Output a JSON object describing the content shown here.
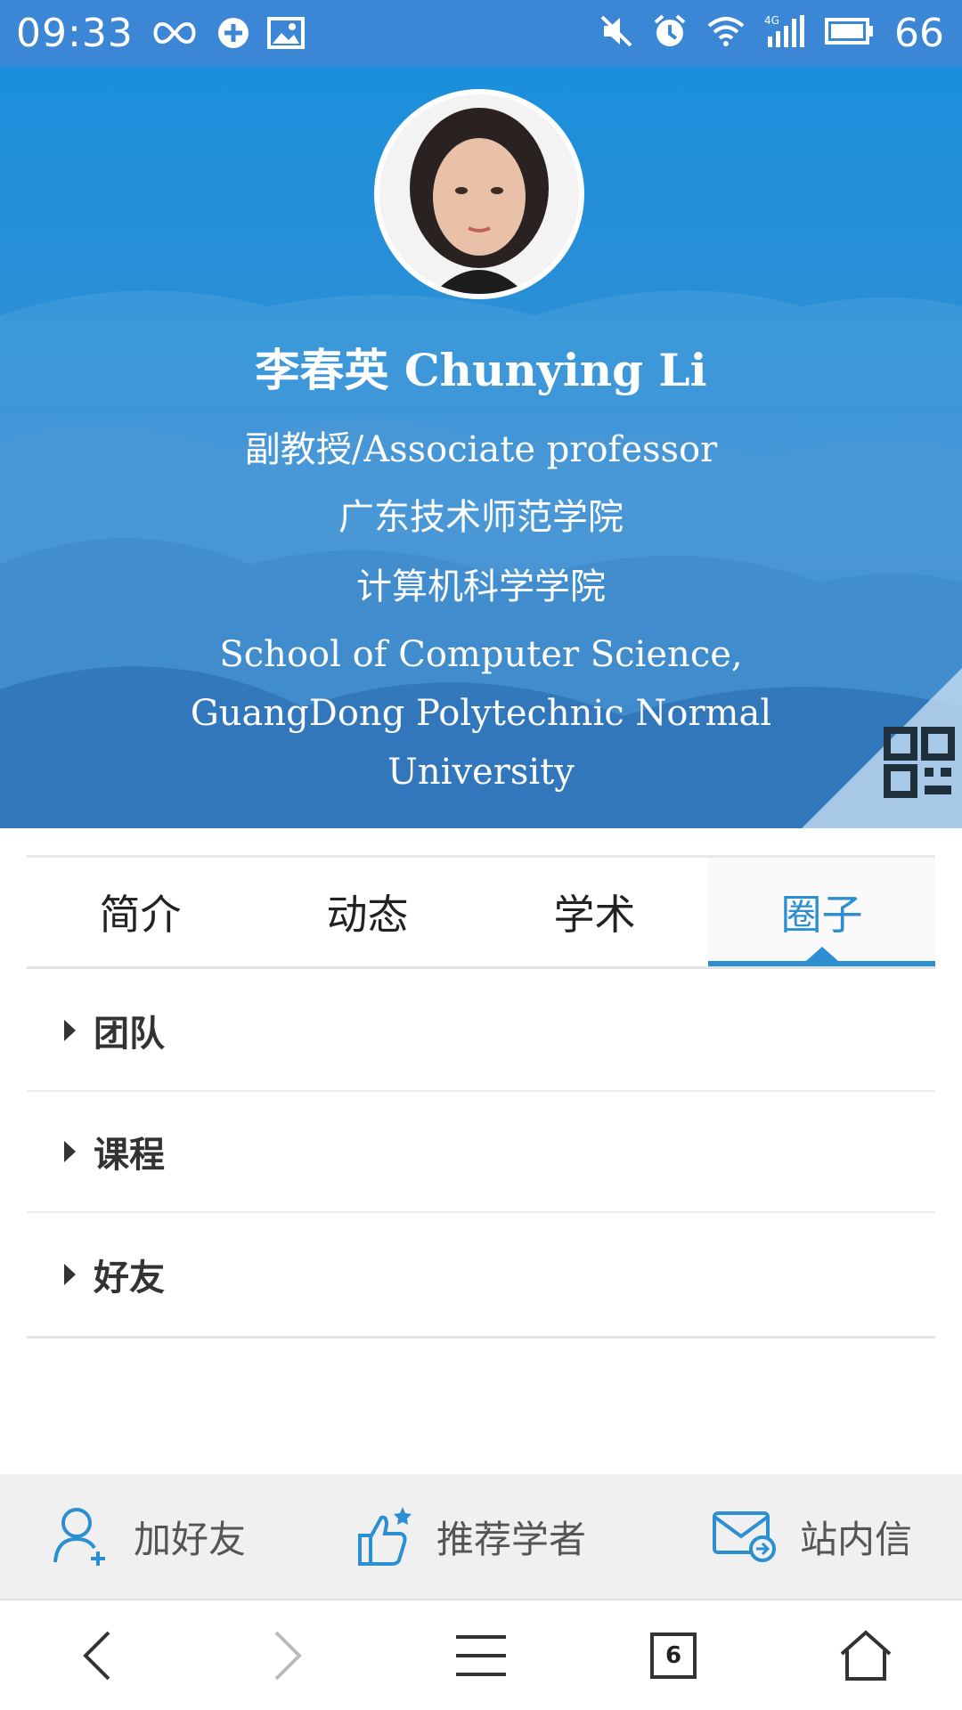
{
  "status_bar": {
    "time": "09:33",
    "battery": "66",
    "icons": [
      "infinity-icon",
      "sync-icon",
      "image-icon",
      "mute-icon",
      "alarm-icon",
      "wifi-icon",
      "signal-4g-icon",
      "battery-icon"
    ]
  },
  "profile": {
    "name": "李春英 Chunying Li",
    "title": "副教授/Associate professor",
    "institution": "广东技术师范学院",
    "department": "计算机科学学院",
    "school_en": "School of Computer Science, GuangDong Polytechnic Normal University"
  },
  "tabs": [
    {
      "label": "简介",
      "active": false
    },
    {
      "label": "动态",
      "active": false
    },
    {
      "label": "学术",
      "active": false
    },
    {
      "label": "圈子",
      "active": true
    }
  ],
  "sections": [
    {
      "label": "团队"
    },
    {
      "label": "课程"
    },
    {
      "label": "好友"
    }
  ],
  "actions": {
    "add_friend": "加好友",
    "recommend": "推荐学者",
    "message": "站内信"
  },
  "browser_nav": {
    "tab_count": "6"
  },
  "colors": {
    "accent": "#2b8fd2",
    "status_bar": "#3c86d6"
  }
}
